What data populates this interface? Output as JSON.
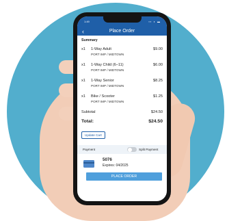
{
  "status": {
    "time": "1:49",
    "icons": "▪▪ ◗ ▬"
  },
  "nav": {
    "back_glyph": "‹",
    "title": "Place Order"
  },
  "summary_label": "Summary",
  "items": [
    {
      "qty": "x1",
      "name": "1-Way Adult",
      "route": "PORT IMP / MIDTOWN",
      "price": "$9.00"
    },
    {
      "qty": "x1",
      "name": "1-Way Child (6–11)",
      "route": "PORT IMP / MIDTOWN",
      "price": "$6.00"
    },
    {
      "qty": "x1",
      "name": "1-Way Senior",
      "route": "PORT IMP / MIDTOWN",
      "price": "$8.25"
    },
    {
      "qty": "x1",
      "name": "Bike / Scooter",
      "route": "PORT IMP / MIDTOWN",
      "price": "$1.25"
    }
  ],
  "subtotal": {
    "label": "Subtotal",
    "value": "$24.50"
  },
  "total": {
    "label": "Total:",
    "value": "$24.50"
  },
  "update_cart_label": "Update Cart",
  "payment": {
    "label": "Payment",
    "split_label": "Split Payment",
    "split_enabled": false
  },
  "card": {
    "number": "5076",
    "expires": "Expires: 04/2025",
    "icon": "credit-card-icon"
  },
  "place_order_label": "PLACE ORDER",
  "colors": {
    "header": "#1f5fa8",
    "button": "#4f9fdc",
    "background_circle": "#52aecd"
  }
}
